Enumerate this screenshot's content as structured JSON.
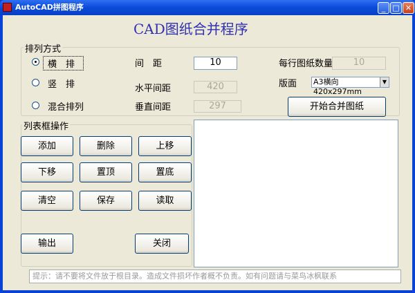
{
  "window": {
    "title": "AutoCAD拼图程序"
  },
  "heading": "CAD图纸合并程序",
  "arrange": {
    "group_label": "排列方式",
    "options": [
      {
        "label": "横　排",
        "selected": true
      },
      {
        "label": "竖　排",
        "selected": false
      },
      {
        "label": "混合排列",
        "selected": false
      }
    ],
    "spacing_label": "间　距",
    "spacing_value": "10",
    "hspacing_label": "水平间距",
    "hspacing_value": "420",
    "vspacing_label": "垂直间距",
    "vspacing_value": "297",
    "per_row_label": "每行图纸数量",
    "per_row_value": "10",
    "layout_label": "版面",
    "layout_value": "A3横向 420x297mm",
    "start_button": "开始合并图纸"
  },
  "list_ops": {
    "group_label": "列表框操作",
    "buttons": [
      "添加",
      "删除",
      "上移",
      "下移",
      "置顶",
      "置底",
      "清空",
      "保存",
      "读取"
    ],
    "output": "输出",
    "close": "关闭"
  },
  "hint": "提示：请不要将文件放于根目录。造成文件损坏作者概不负责。如有问题请与菜鸟冰枫联系"
}
